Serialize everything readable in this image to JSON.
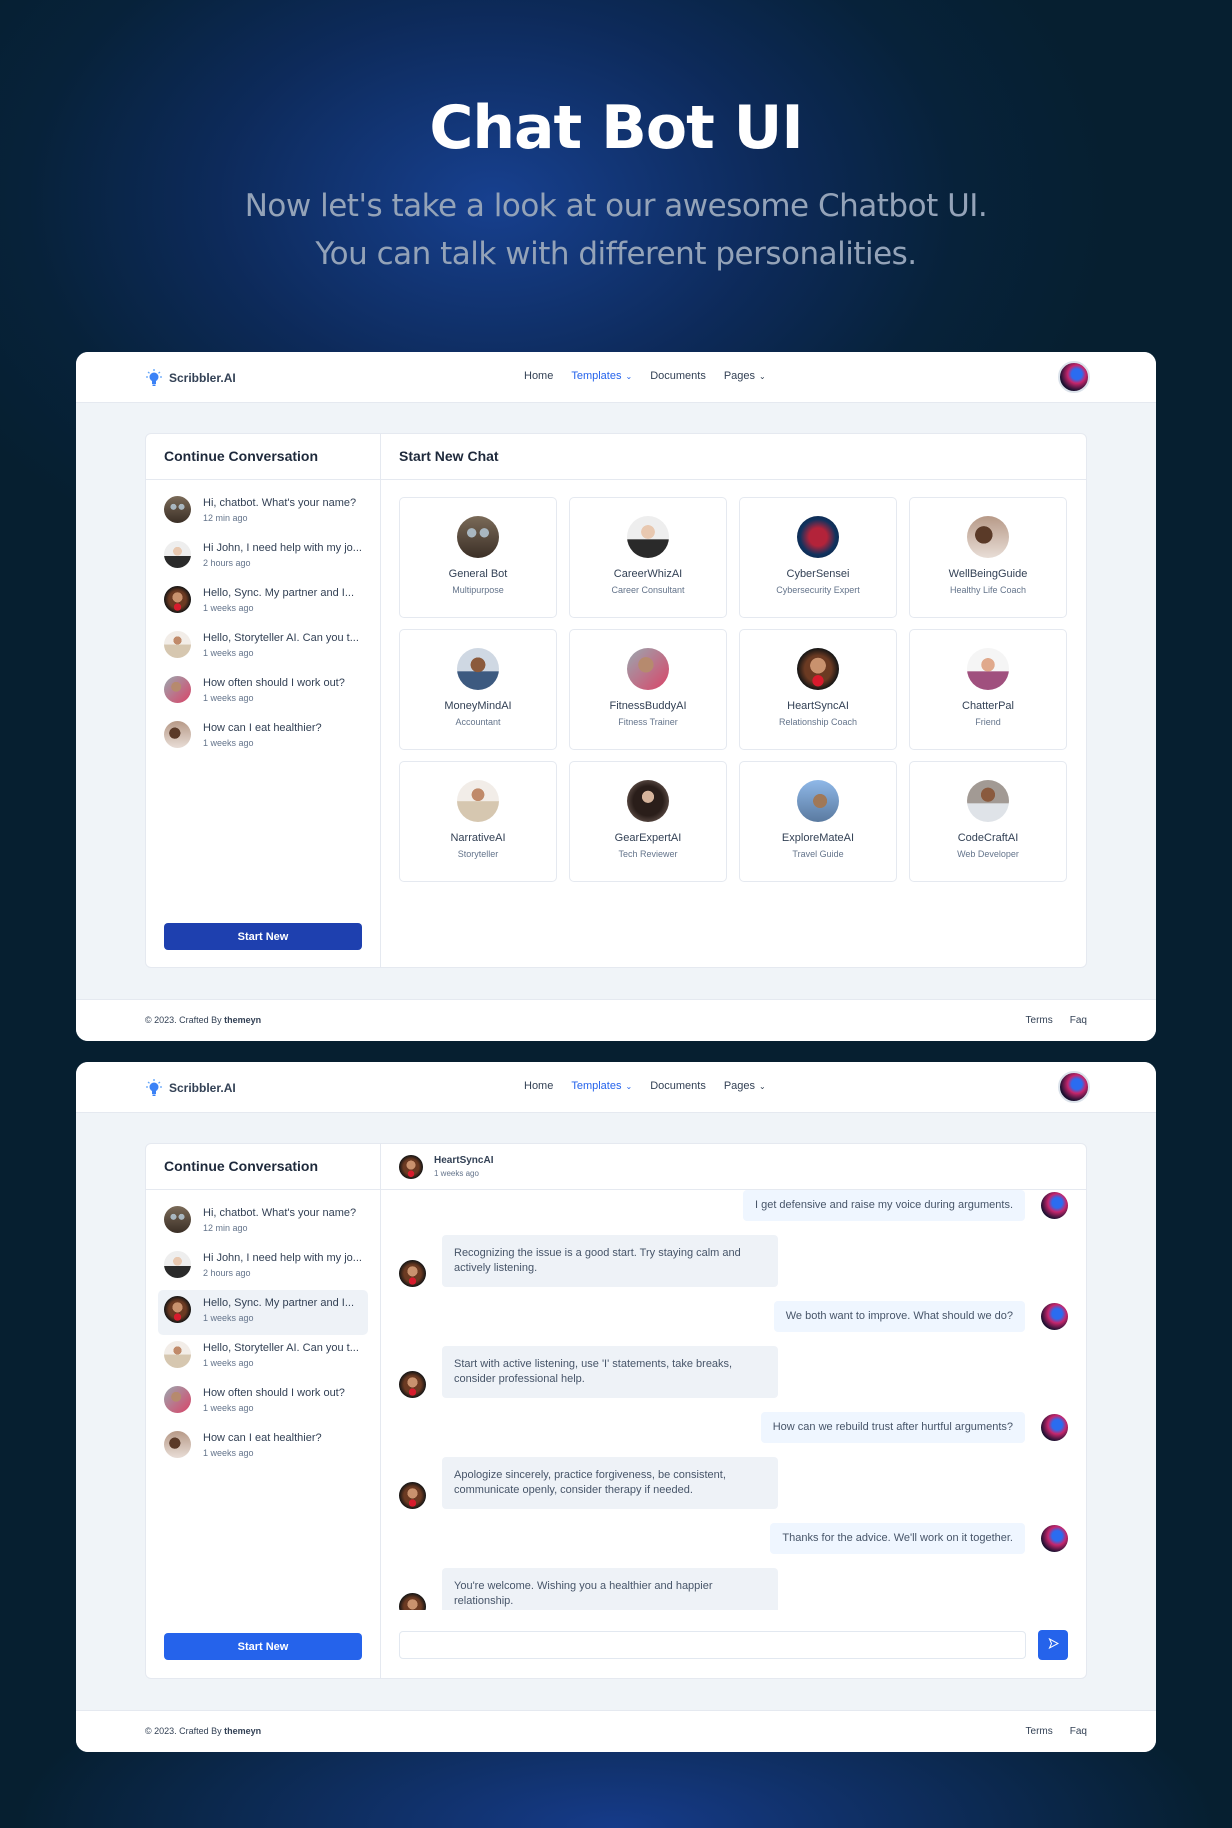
{
  "hero": {
    "title": "Chat Bot UI",
    "subtitle_line1": "Now let's take a look at our awesome Chatbot UI.",
    "subtitle_line2": "You can talk with different personalities."
  },
  "app": {
    "logo_text": "Scribbler.AI",
    "nav": [
      {
        "label": "Home",
        "active": false
      },
      {
        "label": "Templates",
        "active": true,
        "dropdown": true
      },
      {
        "label": "Documents",
        "active": false
      },
      {
        "label": "Pages",
        "active": false,
        "dropdown": true
      }
    ],
    "accent": "#2563eb",
    "footer": {
      "copyright": "© 2023. Crafted By ",
      "author": "themeyn",
      "links": [
        "Terms",
        "Faq"
      ]
    }
  },
  "conversations": {
    "title": "Continue Conversation",
    "items": [
      {
        "message": "Hi, chatbot. What's your name?",
        "time": "12 min ago",
        "avatar": "robot-avatar"
      },
      {
        "message": "Hi John, I need help with my jo...",
        "time": "2 hours ago",
        "avatar": "career-avatar"
      },
      {
        "message": "Hello, Sync. My partner and I...",
        "time": "1 weeks ago",
        "avatar": "heart-avatar"
      },
      {
        "message": "Hello, Storyteller AI. Can you t...",
        "time": "1 weeks ago",
        "avatar": "narrative-avatar"
      },
      {
        "message": "How often should I work out?",
        "time": "1 weeks ago",
        "avatar": "fitness-avatar"
      },
      {
        "message": "How can I eat healthier?",
        "time": "1 weeks ago",
        "avatar": "wellbeing-avatar"
      }
    ],
    "start_new_label": "Start New"
  },
  "new_chat": {
    "title": "Start New Chat",
    "bots": [
      {
        "name": "General Bot",
        "role": "Multipurpose"
      },
      {
        "name": "CareerWhizAI",
        "role": "Career Consultant"
      },
      {
        "name": "CyberSensei",
        "role": "Cybersecurity Expert"
      },
      {
        "name": "WellBeingGuide",
        "role": "Healthy Life Coach"
      },
      {
        "name": "MoneyMindAI",
        "role": "Accountant"
      },
      {
        "name": "FitnessBuddyAI",
        "role": "Fitness Trainer"
      },
      {
        "name": "HeartSyncAI",
        "role": "Relationship Coach"
      },
      {
        "name": "ChatterPal",
        "role": "Friend"
      },
      {
        "name": "NarrativeAI",
        "role": "Storyteller"
      },
      {
        "name": "GearExpertAI",
        "role": "Tech Reviewer"
      },
      {
        "name": "ExploreMateAI",
        "role": "Travel Guide"
      },
      {
        "name": "CodeCraftAI",
        "role": "Web Developer"
      }
    ]
  },
  "chat": {
    "bot_name": "HeartSyncAI",
    "bot_time": "1 weeks ago",
    "selected_conversation_index": 2,
    "messages": [
      {
        "from": "user",
        "text": "I get defensive and raise my voice during arguments."
      },
      {
        "from": "bot",
        "text": "Recognizing the issue is a good start. Try staying calm and actively listening."
      },
      {
        "from": "user",
        "text": "We both want to improve. What should we do?"
      },
      {
        "from": "bot",
        "text": "Start with active listening, use 'I' statements, take breaks, consider professional help."
      },
      {
        "from": "user",
        "text": "How can we rebuild trust after hurtful arguments?"
      },
      {
        "from": "bot",
        "text": "Apologize sincerely, practice forgiveness, be consistent, communicate openly, consider therapy if needed."
      },
      {
        "from": "user",
        "text": "Thanks for the advice. We'll work on it together."
      },
      {
        "from": "bot",
        "text": "You're welcome. Wishing you a healthier and happier relationship."
      }
    ],
    "input_value": "",
    "input_placeholder": "",
    "send_icon": "send-icon"
  }
}
